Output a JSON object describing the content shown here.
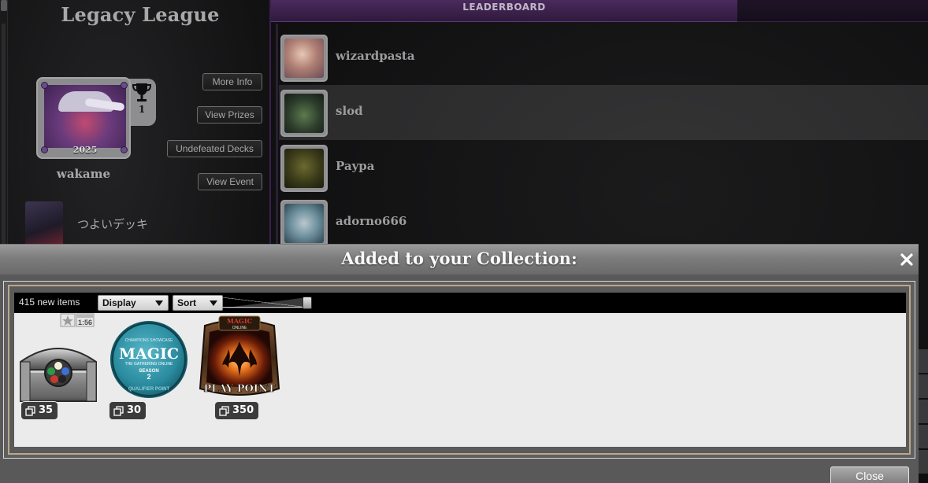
{
  "league": {
    "title": "Legacy League",
    "player_name": "wakame",
    "badge_year": "2025",
    "trophy_count": "1",
    "buttons": {
      "more_info": "More Info",
      "view_prizes": "View Prizes",
      "undefeated_decks": "Undefeated Decks",
      "view_event": "View Event"
    },
    "deck_label": "つよいデッキ"
  },
  "leaderboard": {
    "header": "LEADERBOARD",
    "rows": [
      {
        "name": "wizardpasta",
        "avatar_color": "#c79a8a",
        "highlighted": false
      },
      {
        "name": "slod",
        "avatar_color": "#3c5a3a",
        "highlighted": true
      },
      {
        "name": "Paypa",
        "avatar_color": "#4a4a22",
        "highlighted": false
      },
      {
        "name": "adorno666",
        "avatar_color": "#6a8a9a",
        "highlighted": false
      }
    ]
  },
  "modal": {
    "title": "Added to your Collection:",
    "item_count_label": "415 new items",
    "display_label": "Display",
    "sort_label": "Sort",
    "close_label": "Close",
    "items": [
      {
        "name": "treasure-chest",
        "quantity": "35",
        "tag": "1:56"
      },
      {
        "name": "magic-qualifier-point",
        "quantity": "30",
        "art_lines": [
          "CHAMPIONS SHOWCASE",
          "MAGIC",
          "THE GATHERING ONLINE",
          "SEASON",
          "2",
          "QUALIFIER POINT"
        ]
      },
      {
        "name": "play-point",
        "quantity": "350",
        "art_lines": [
          "MAGIC",
          "ONLINE",
          "PLAY POINT"
        ]
      }
    ]
  },
  "colors": {
    "league_purple": "#4b2a5e",
    "modal_grey": "#595959",
    "gold_border": "#bba78a"
  }
}
